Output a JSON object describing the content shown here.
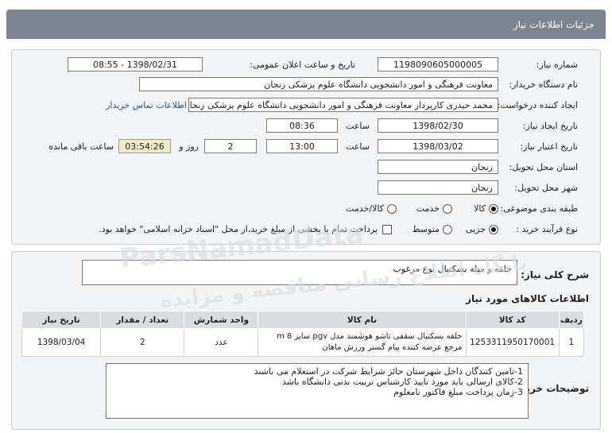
{
  "header": {
    "title": "جزئیات اطلاعات نیاز"
  },
  "details": {
    "need_number_label": "شماره نیاز:",
    "need_number": "1198090605000005",
    "announce_label": "تاریخ و ساعت اعلان عمومی:",
    "announce_value": "1398/02/31 - 08:55",
    "buyer_org_label": "نام دستگاه خریدار:",
    "buyer_org": "معاونت فرهنگی و امور دانشجویی دانشگاه علوم پزشکی زنجان",
    "requester_label": "ایجاد کننده درخواست:",
    "requester": "محمد حیدری کارپرداز معاونت فرهنگی و امور دانشجویی دانشگاه علوم پزشکی زنجان",
    "contact_link": "اطلاعات تماس خریدار",
    "created_label": "تاریخ ایجاد نیاز:",
    "created_date": "1398/02/30",
    "created_time_label": "ساعت",
    "created_time": "08:36",
    "valid_label": "تاریخ اعتبار نیاز:",
    "valid_date": "1398/03/02",
    "valid_time_label": "ساعت",
    "valid_time": "13:00",
    "days": "2",
    "days_label": "روز و",
    "remaining": "03:54:26",
    "remaining_label": "ساعت باقی مانده",
    "province_label": "استان محل تحویل:",
    "province": "زنجان",
    "city_label": "شهر محل تحویل:",
    "city": "زنجان",
    "category_label": "طبقه بندی موضوعی:",
    "category_options": [
      "کالا",
      "خدمت",
      "کالا/خدمت"
    ],
    "process_label": "نوع فرآیند خرید :",
    "process_options": [
      "جزیی",
      "متوسط"
    ],
    "payment_note": "پرداخت تمام یا بخشی از مبلغ خرید،از محل \"اسناد خزانه اسلامی\" خواهد بود."
  },
  "summary": {
    "label": "شرح کلی نیاز:",
    "value": "حلقه و میله بسکتبال نوع مرغوب"
  },
  "items_section": {
    "title": "اطلاعات کالاهای مورد نیاز",
    "columns": [
      "ردیف",
      "کد کالا",
      "نام کالا",
      "واحد شمارش",
      "تعداد / مقدار",
      "تاریخ نیاز"
    ],
    "rows": [
      {
        "row": "1",
        "code": "1253311950170001",
        "name_line1": "حلقه بسکتبال سقفی تاشو هوشمند مدل pgv سایز 8 m",
        "name_line2": "مرجع عرضه کننده پیام گستر ورزش ماهان",
        "unit": "عدد",
        "qty": "2",
        "date": "1398/03/04"
      }
    ]
  },
  "notes": {
    "label": "توضیحات خریدار:",
    "lines": [
      "1-تامین کنندگان داخل شهرستان حائز شرایط شرکت در استعلام می باشند",
      "2-کالای ارسالی باید مورد تایید کارشناس تربیت بدنی دانشگاه باشد",
      "3-زمان پرداخت مبلغ فاکتور نامعلوم"
    ]
  },
  "watermark": {
    "line1": "ParsNamadData",
    "line2": "پایگاه اطلاع رسانی مناقصه و مزایده"
  }
}
